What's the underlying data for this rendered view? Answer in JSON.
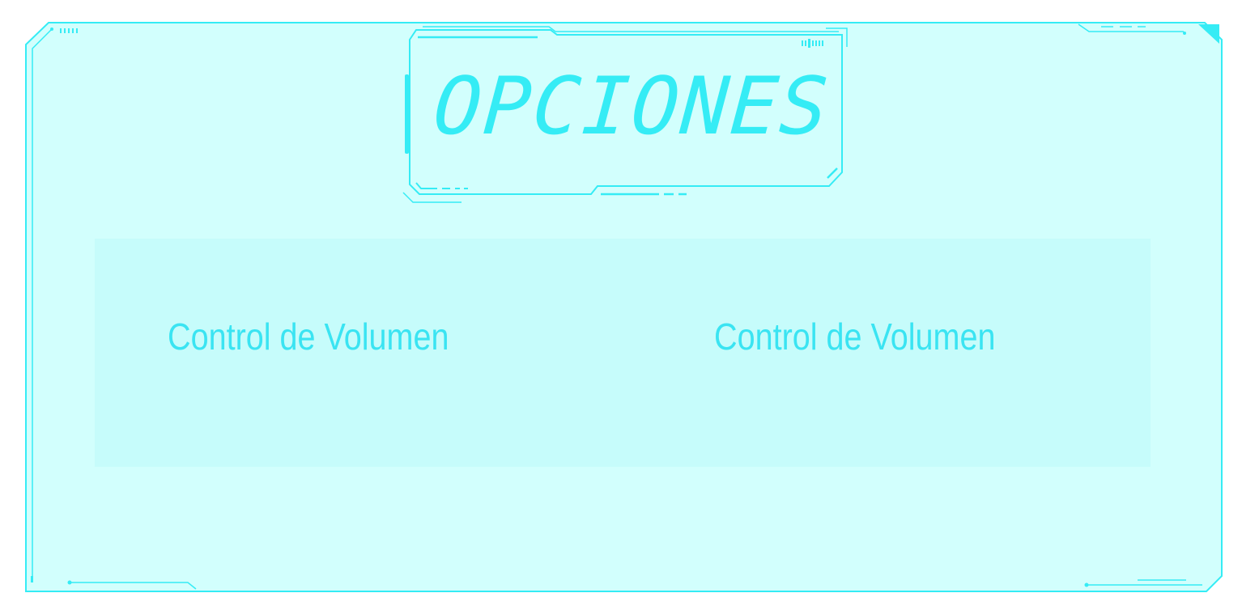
{
  "menu": {
    "title": "OPCIONES",
    "options": [
      {
        "label": "Control de Volumen"
      },
      {
        "label": "Control de Volumen"
      }
    ]
  },
  "colors": {
    "frame_fill": "#d2fffd",
    "panel_fill": "#c6fcfb",
    "accent": "#35ecf5",
    "text": "#3ae4f2"
  },
  "icons": [
    "hud-frame",
    "title-frame"
  ]
}
